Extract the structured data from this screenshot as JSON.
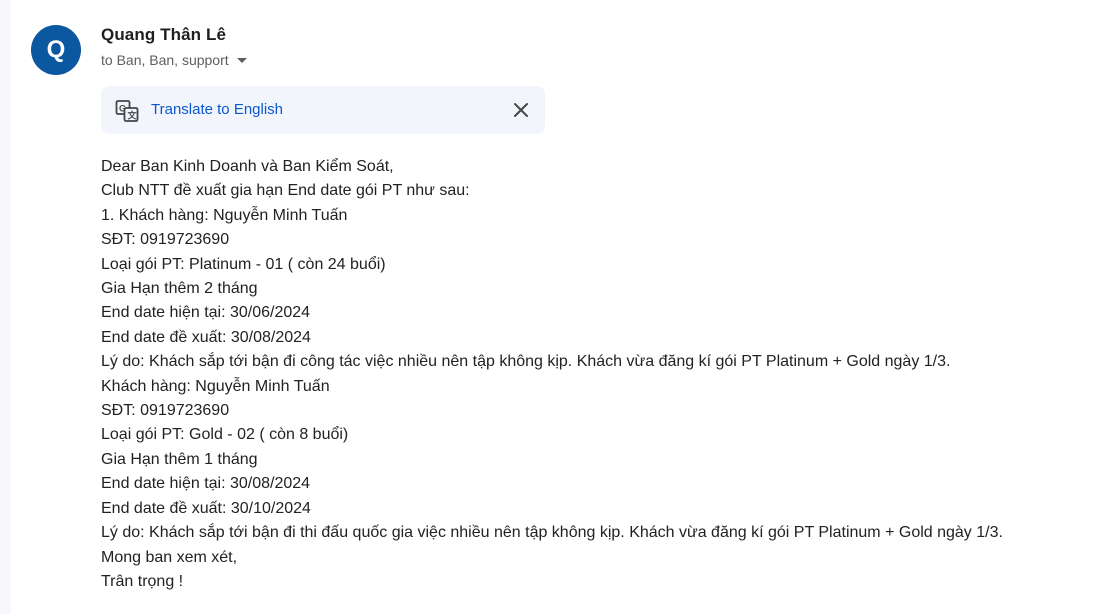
{
  "sender": {
    "avatar_letter": "Q",
    "avatar_color": "#0b57a0",
    "name": "Quang Thân Lê",
    "recipients": "to Ban, Ban, support"
  },
  "translate": {
    "link_label": "Translate to English",
    "icon": "translate-icon",
    "close_icon": "close-icon"
  },
  "email_body": {
    "lines": [
      "Dear Ban Kinh Doanh và Ban Kiểm Soát,",
      "Club NTT đề xuất gia hạn End date gói PT như sau:",
      "1. Khách hàng: Nguyễn Minh Tuấn",
      "SĐT: 0919723690",
      "Loại gói PT: Platinum - 01 ( còn 24 buổi)",
      "Gia Hạn thêm 2 tháng",
      "End date hiện tại: 30/06/2024",
      "End date đề xuất: 30/08/2024",
      "Lý do: Khách sắp tới bận đi công tác việc nhiều nên tập không kịp. Khách vừa đăng kí gói PT Platinum + Gold ngày 1/3.",
      "Khách hàng: Nguyễn Minh Tuấn",
      "SĐT: 0919723690",
      "Loại gói PT: Gold - 02 ( còn 8 buổi)",
      "Gia Hạn thêm 1 tháng",
      "End date hiện tại: 30/08/2024",
      "End date đề xuất: 30/10/2024",
      "Lý do: Khách sắp tới bận đi thi đấu quốc gia việc nhiều nên tập không kịp. Khách vừa đăng kí gói PT Platinum + Gold ngày 1/3.",
      "Mong ban xem xét,",
      "Trân trọng !"
    ]
  }
}
